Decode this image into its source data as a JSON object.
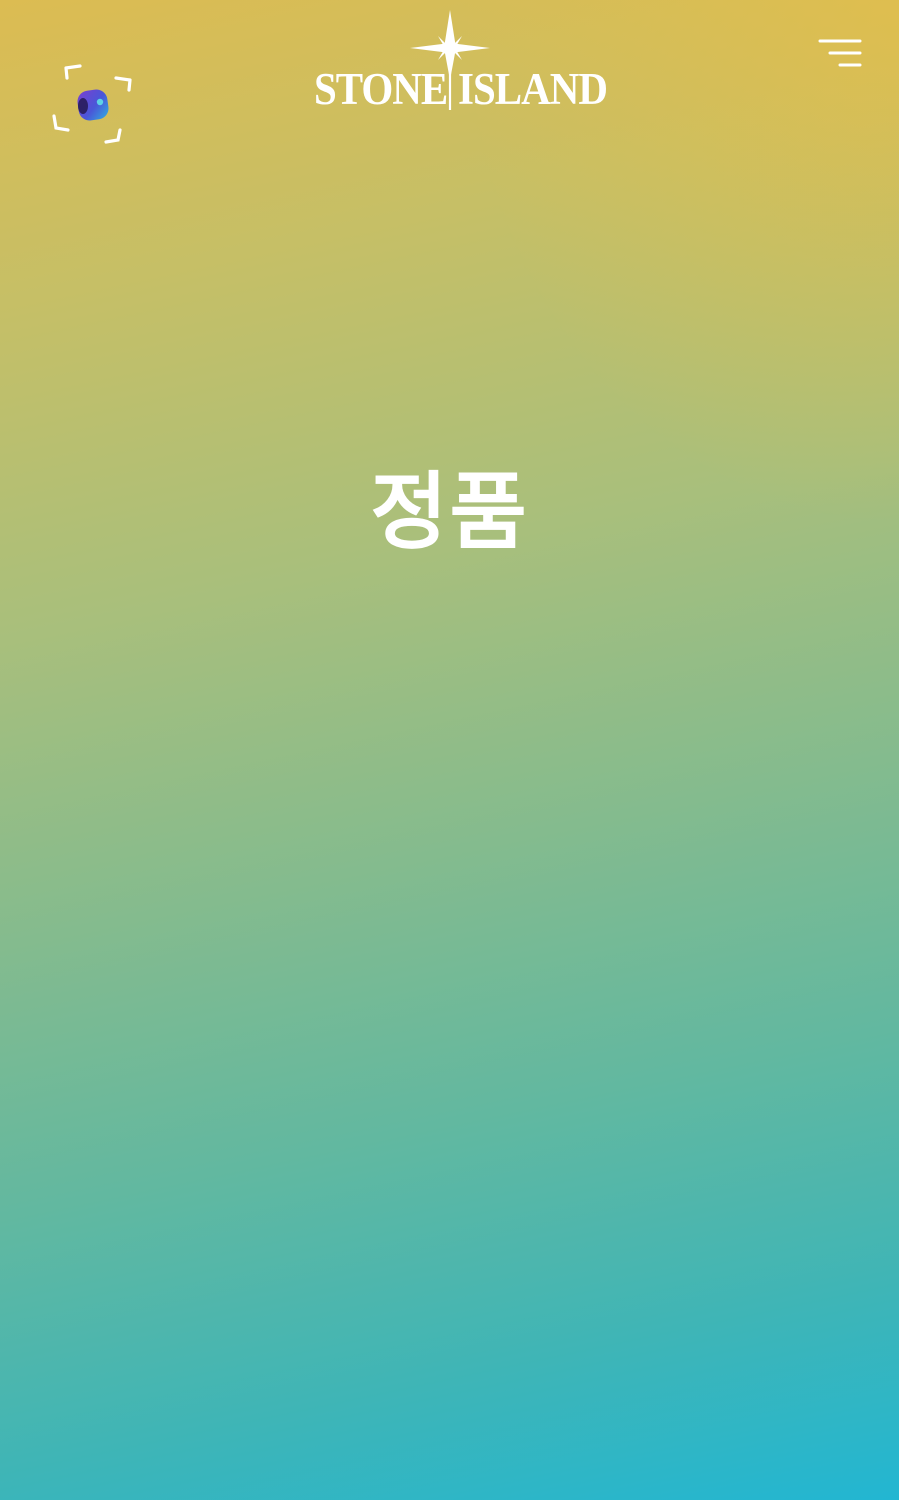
{
  "header": {
    "brand": {
      "left_word": "STONE",
      "right_word": "ISLAND"
    },
    "scan_button_icon": "camera-scan-icon",
    "menu_button_icon": "hamburger-menu-icon"
  },
  "main": {
    "title": "정품"
  },
  "colors": {
    "gradient_top": "#dcbc52",
    "gradient_bottom": "#22b6d2",
    "foreground": "#ffffff"
  }
}
